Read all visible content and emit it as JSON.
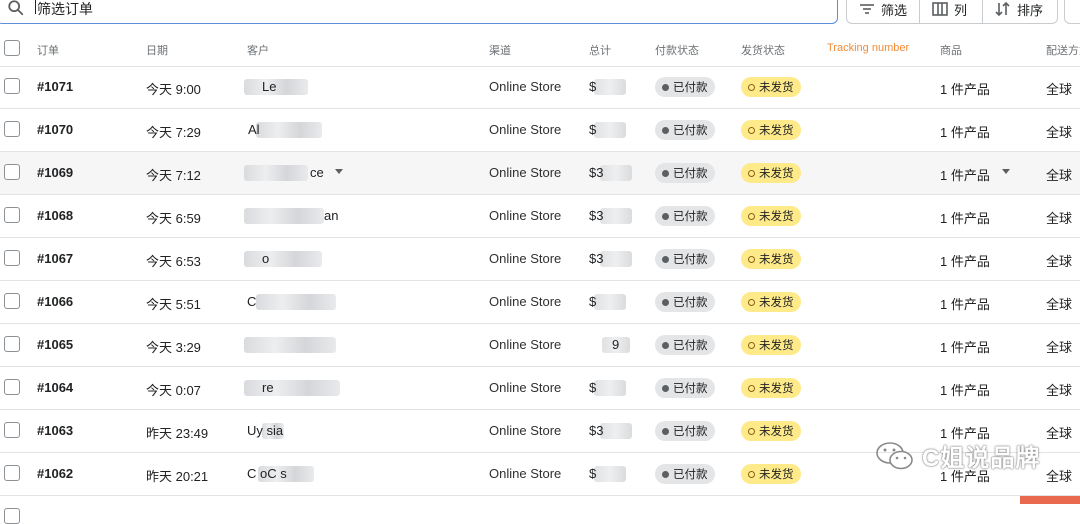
{
  "toolbar": {
    "search_value": "筛选订单",
    "filter_label": "筛选",
    "columns_label": "列",
    "sort_label": "排序"
  },
  "columns": {
    "order": "订单",
    "date": "日期",
    "customer": "客户",
    "channel": "渠道",
    "total": "总计",
    "payment": "付款状态",
    "fulfillment": "发货状态",
    "tracking": "Tracking number",
    "items": "商品",
    "delivery": "配送方式"
  },
  "rows": [
    {
      "order": "#1071",
      "date": "今天 9:00",
      "customer_partial": "Le",
      "channel": "Online Store",
      "total_partial": "$",
      "payment": "已付款",
      "fulfillment": "未发货",
      "items": "1 件产品",
      "delivery": "全球"
    },
    {
      "order": "#1070",
      "date": "今天 7:29",
      "customer_partial": "Al",
      "channel": "Online Store",
      "total_partial": "$",
      "payment": "已付款",
      "fulfillment": "未发货",
      "items": "1 件产品",
      "delivery": "全球"
    },
    {
      "order": "#1069",
      "date": "今天 7:12",
      "customer_partial": "ce",
      "channel": "Online Store",
      "total_partial": "$3",
      "payment": "已付款",
      "fulfillment": "未发货",
      "items": "1 件产品",
      "delivery": "全球"
    },
    {
      "order": "#1068",
      "date": "今天 6:59",
      "customer_partial": "an",
      "channel": "Online Store",
      "total_partial": "$3",
      "payment": "已付款",
      "fulfillment": "未发货",
      "items": "1 件产品",
      "delivery": "全球"
    },
    {
      "order": "#1067",
      "date": "今天 6:53",
      "customer_partial": "o",
      "channel": "Online Store",
      "total_partial": "$3",
      "payment": "已付款",
      "fulfillment": "未发货",
      "items": "1 件产品",
      "delivery": "全球"
    },
    {
      "order": "#1066",
      "date": "今天 5:51",
      "customer_partial": "C",
      "channel": "Online Store",
      "total_partial": "$",
      "payment": "已付款",
      "fulfillment": "未发货",
      "items": "1 件产品",
      "delivery": "全球"
    },
    {
      "order": "#1065",
      "date": "今天 3:29",
      "customer_partial": "",
      "channel": "Online Store",
      "total_partial": "9",
      "payment": "已付款",
      "fulfillment": "未发货",
      "items": "1 件产品",
      "delivery": "全球"
    },
    {
      "order": "#1064",
      "date": "今天 0:07",
      "customer_partial": "re",
      "channel": "Online Store",
      "total_partial": "$",
      "payment": "已付款",
      "fulfillment": "未发货",
      "items": "1 件产品",
      "delivery": "全球"
    },
    {
      "order": "#1063",
      "date": "昨天 23:49",
      "customer_partial": "Uy  sia",
      "channel": "Online Store",
      "total_partial": "$3",
      "payment": "已付款",
      "fulfillment": "未发货",
      "items": "1 件产品",
      "delivery": "全球"
    },
    {
      "order": "#1062",
      "date": "昨天 20:21",
      "customer_partial": "C  oC  s",
      "channel": "Online Store",
      "total_partial": "$",
      "payment": "已付款",
      "fulfillment": "未发货",
      "items": "1 件产品",
      "delivery": "全球"
    }
  ],
  "watermark": {
    "text": "C姐说品牌"
  },
  "colors": {
    "accent_search_border": "#5c8fd6",
    "tracking_header": "#f08c38",
    "unfulfilled_badge": "#ffea8a",
    "paid_badge": "#e4e5e7"
  }
}
